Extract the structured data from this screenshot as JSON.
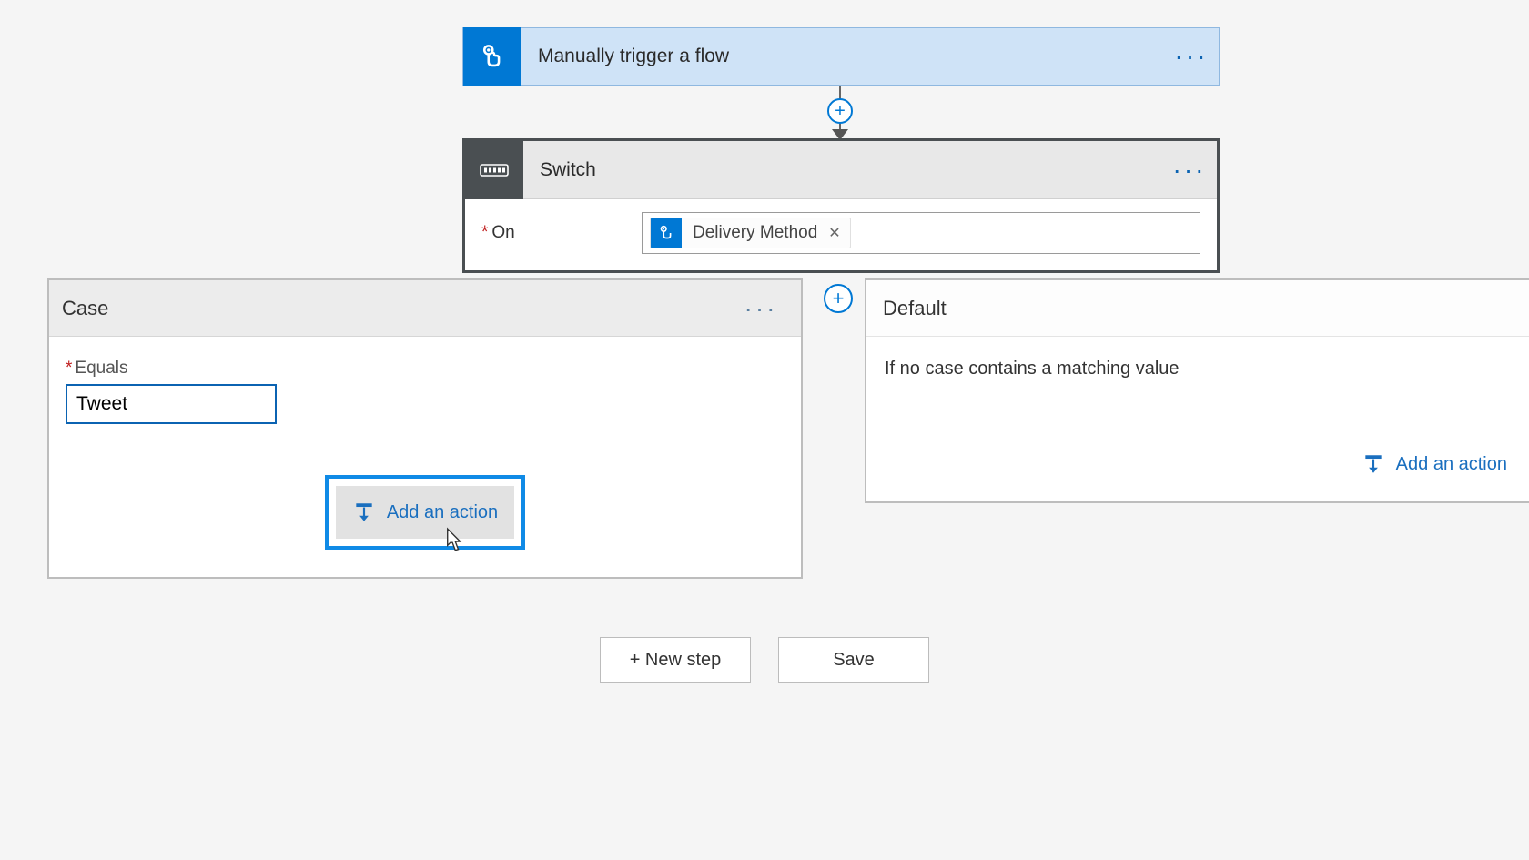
{
  "trigger": {
    "title": "Manually trigger a flow"
  },
  "switch": {
    "title": "Switch",
    "on_label": "On",
    "token_label": "Delivery Method"
  },
  "case": {
    "title": "Case",
    "equals_label": "Equals",
    "equals_value": "Tweet",
    "add_action_label": "Add an action"
  },
  "default": {
    "title": "Default",
    "description": "If no case contains a matching value",
    "add_action_label": "Add an action"
  },
  "buttons": {
    "new_step": "+ New step",
    "save": "Save"
  }
}
